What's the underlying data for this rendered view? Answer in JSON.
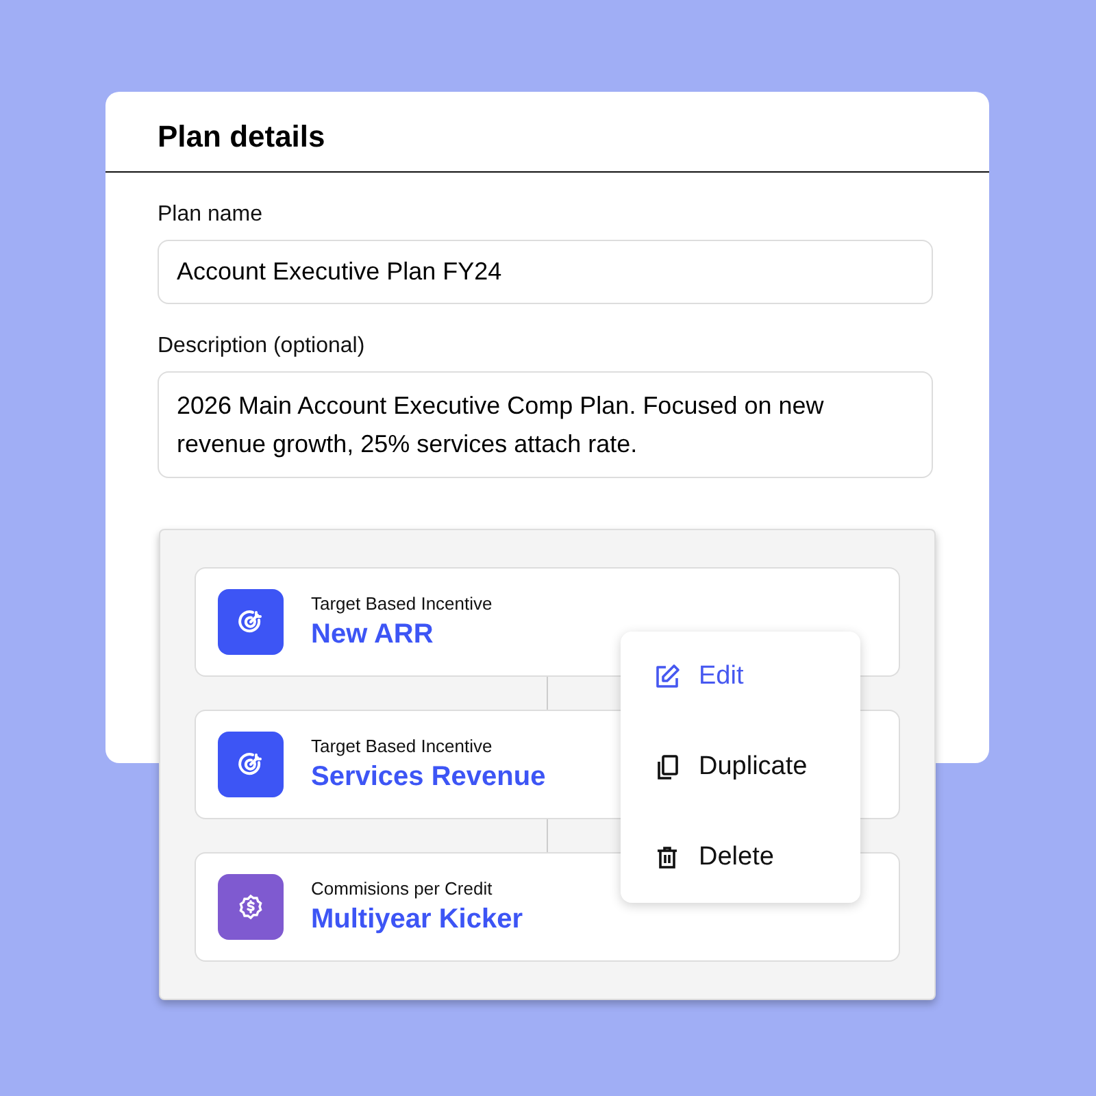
{
  "card": {
    "title": "Plan details",
    "fields": [
      {
        "label": "Plan name",
        "value": "Account Executive Plan FY24",
        "kind": "input"
      },
      {
        "label": "Description (optional)",
        "value": "2026 Main Account Executive Comp Plan. Focused on new revenue growth, 25% services attach rate.",
        "kind": "textarea"
      }
    ]
  },
  "components": [
    {
      "type": "Target Based Incentive",
      "name": "New ARR",
      "kind": "target",
      "color": "#3d55f5"
    },
    {
      "type": "Target Based Incentive",
      "name": "Services Revenue",
      "kind": "target",
      "color": "#3d55f5"
    },
    {
      "type": "Commisions per Credit",
      "name": "Multiyear Kicker",
      "kind": "commission",
      "color": "#7f5ad0"
    }
  ],
  "menu": [
    {
      "label": "Edit",
      "kind": "edit",
      "selected": true
    },
    {
      "label": "Duplicate",
      "kind": "duplicate",
      "selected": false
    },
    {
      "label": "Delete",
      "kind": "delete",
      "selected": false
    }
  ]
}
